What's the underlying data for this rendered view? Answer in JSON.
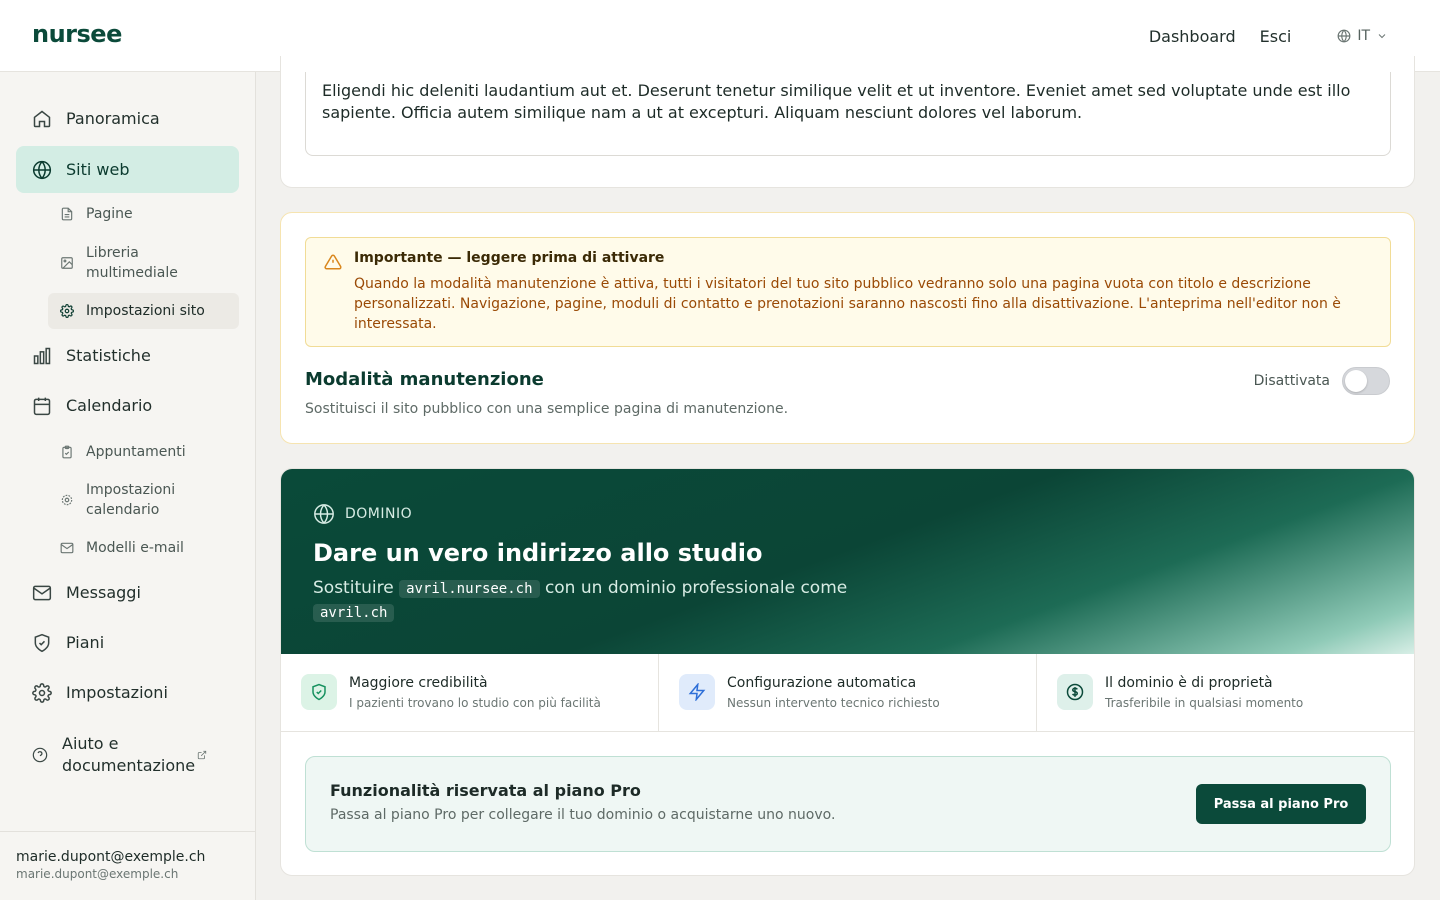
{
  "app": {
    "logo": "nursee"
  },
  "topnav": {
    "dashboard": "Dashboard",
    "logout": "Esci",
    "language": "IT"
  },
  "sidebar": {
    "items": [
      {
        "label": "Panoramica",
        "icon": "home-icon"
      },
      {
        "label": "Siti web",
        "icon": "globe-icon",
        "active": true
      },
      {
        "label": "Statistiche",
        "icon": "bar-chart-icon"
      },
      {
        "label": "Calendario",
        "icon": "calendar-icon"
      },
      {
        "label": "Messaggi",
        "icon": "mail-icon"
      },
      {
        "label": "Piani",
        "icon": "shield-icon"
      },
      {
        "label": "Impostazioni",
        "icon": "gear-icon"
      },
      {
        "label": "Aiuto e documentazione",
        "icon": "help-circle-icon"
      }
    ],
    "siti_sub": [
      {
        "label": "Pagine",
        "icon": "file-icon"
      },
      {
        "label": "Libreria multimediale",
        "icon": "image-icon"
      },
      {
        "label": "Impostazioni sito",
        "icon": "gear-icon",
        "active": true
      }
    ],
    "calendario_sub": [
      {
        "label": "Appuntamenti",
        "icon": "clipboard-icon"
      },
      {
        "label": "Impostazioni calendario",
        "icon": "gear-icon"
      },
      {
        "label": "Modelli e-mail",
        "icon": "mail-icon"
      }
    ],
    "user": {
      "name": "marie.dupont@exemple.ch",
      "email": "marie.dupont@exemple.ch"
    }
  },
  "description": {
    "text": "Eligendi hic deleniti laudantium aut et. Deserunt tenetur similique velit et ut inventore. Eveniet amet sed voluptate unde est illo sapiente. Officia autem similique nam a ut at excepturi. Aliquam nesciunt dolores vel laborum."
  },
  "maintenance": {
    "warning_title": "Importante — leggere prima di attivare",
    "warning_body": "Quando la modalità manutenzione è attiva, tutti i visitatori del tuo sito pubblico vedranno solo una pagina vuota con titolo e descrizione personalizzati. Navigazione, pagine, moduli di contatto e prenotazioni saranno nascosti fino alla disattivazione. L'anteprima nell'editor non è interessata.",
    "title": "Modalità manutenzione",
    "description": "Sostituisci il sito pubblico con una semplice pagina di manutenzione.",
    "status_label": "Disattivata",
    "enabled": false
  },
  "domain": {
    "tag": "DOMINIO",
    "title": "Dare un vero indirizzo allo studio",
    "sub_before": "Sostituire",
    "current_domain": "avril.nursee.ch",
    "sub_middle": "con un dominio professionale come",
    "example_domain": "avril.ch",
    "features": [
      {
        "title": "Maggiore credibilità",
        "subtitle": "I pazienti trovano lo studio con più facilità",
        "icon": "shield-check-icon"
      },
      {
        "title": "Configurazione automatica",
        "subtitle": "Nessun intervento tecnico richiesto",
        "icon": "lightning-icon"
      },
      {
        "title": "Il dominio è di proprietà",
        "subtitle": "Trasferibile in qualsiasi momento",
        "icon": "dollar-circle-icon"
      }
    ],
    "pro_title": "Funzionalità riservata al piano Pro",
    "pro_desc": "Passa al piano Pro per collegare il tuo dominio o acquistarne uno nuovo.",
    "pro_button": "Passa al piano Pro"
  },
  "colors": {
    "brand": "#0b4a3a",
    "active_nav": "#d3ede4",
    "warning_bg": "#fffbea",
    "warning_text": "#9a4a06"
  }
}
